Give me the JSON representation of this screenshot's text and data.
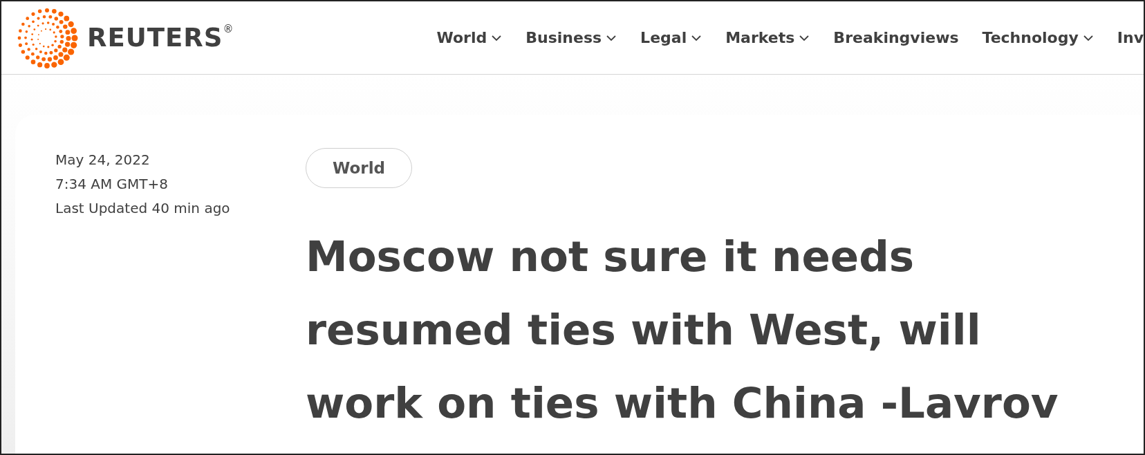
{
  "logo": {
    "wordmark": "REUTERS",
    "mark": "®"
  },
  "nav": [
    {
      "label": "World",
      "has_menu": true
    },
    {
      "label": "Business",
      "has_menu": true
    },
    {
      "label": "Legal",
      "has_menu": true
    },
    {
      "label": "Markets",
      "has_menu": true
    },
    {
      "label": "Breakingviews",
      "has_menu": false
    },
    {
      "label": "Technology",
      "has_menu": true
    },
    {
      "label": "Inv",
      "has_menu": false
    }
  ],
  "article": {
    "date": "May 24, 2022",
    "time": "7:34 AM GMT+8",
    "updated": "Last Updated 40 min ago",
    "topic": "World",
    "headline": [
      "Moscow not sure it needs",
      "resumed ties with West, will",
      "work on ties with China -Lavrov"
    ]
  }
}
